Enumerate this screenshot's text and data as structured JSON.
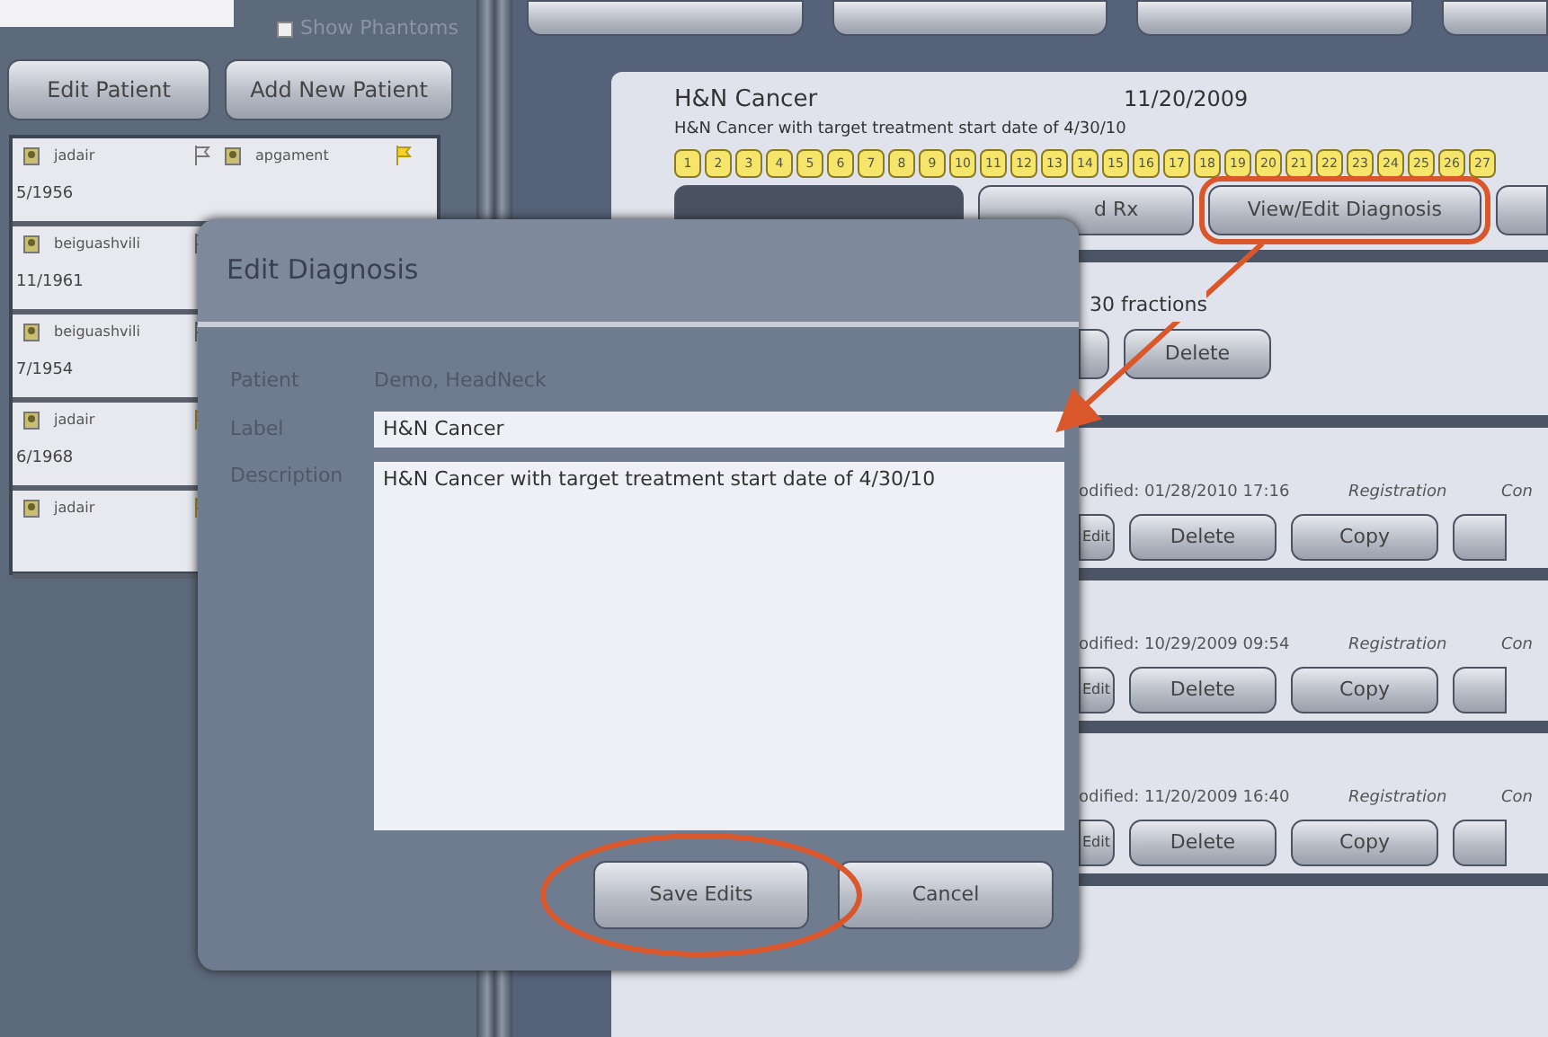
{
  "left_panel": {
    "show_phantoms": {
      "label": "Show Phantoms",
      "checked": false
    },
    "buttons": [
      "Edit Patient",
      "Add New Patient"
    ],
    "patients": [
      {
        "entries": [
          {
            "name": "jadair",
            "flagged": false
          },
          {
            "name": "apgament",
            "flagged": true
          }
        ],
        "date": "5/1956"
      },
      {
        "entries": [
          {
            "name": "beiguashvili",
            "flagged": false
          }
        ],
        "date": "11/1961"
      },
      {
        "entries": [
          {
            "name": "beiguashvili",
            "flagged": false
          }
        ],
        "date": "7/1954"
      },
      {
        "entries": [
          {
            "name": "jadair",
            "flagged": true
          }
        ],
        "date": "6/1968"
      },
      {
        "entries": [
          {
            "name": "jadair",
            "flagged": true
          }
        ]
      }
    ]
  },
  "diagnosis": {
    "title": "H&N Cancer",
    "date": "11/20/2009",
    "description": "H&N Cancer with target treatment start date of 4/30/10",
    "fractions": [
      "1",
      "2",
      "3",
      "4",
      "5",
      "6",
      "7",
      "8",
      "9",
      "10",
      "11",
      "12",
      "13",
      "14",
      "15",
      "16",
      "17",
      "18",
      "19",
      "20",
      "21",
      "22",
      "23",
      "24",
      "25",
      "26",
      "27"
    ],
    "buttons": [
      {
        "label": "d Rx",
        "highlighted": false
      },
      {
        "label": "View/Edit Diagnosis",
        "highlighted": true
      }
    ]
  },
  "prescription": {
    "summary": "30 fractions",
    "buttons": [
      "Delete"
    ]
  },
  "plans": [
    {
      "modified": "odified: 01/28/2010 17:16",
      "registration": "Registration",
      "column_3": "Con",
      "buttons": [
        "Edit",
        "Delete",
        "Copy"
      ]
    },
    {
      "modified": "odified: 10/29/2009 09:54",
      "registration": "Registration",
      "column_3": "Con",
      "buttons": [
        "Edit",
        "Delete",
        "Copy"
      ]
    },
    {
      "modified": "odified: 11/20/2009 16:40",
      "registration": "Registration",
      "column_3": "Con",
      "buttons": [
        "Edit",
        "Delete",
        "Copy"
      ]
    }
  ],
  "dialog": {
    "title": "Edit Diagnosis",
    "patient_label": "Patient",
    "patient": "Demo, HeadNeck",
    "label_label": "Label",
    "label_value": "H&N Cancer",
    "description_label": "Description",
    "description_value": "H&N Cancer with target treatment start date of 4/30/10",
    "buttons": [
      {
        "label": "Save Edits",
        "circled": true
      },
      {
        "label": "Cancel",
        "circled": false
      }
    ]
  }
}
